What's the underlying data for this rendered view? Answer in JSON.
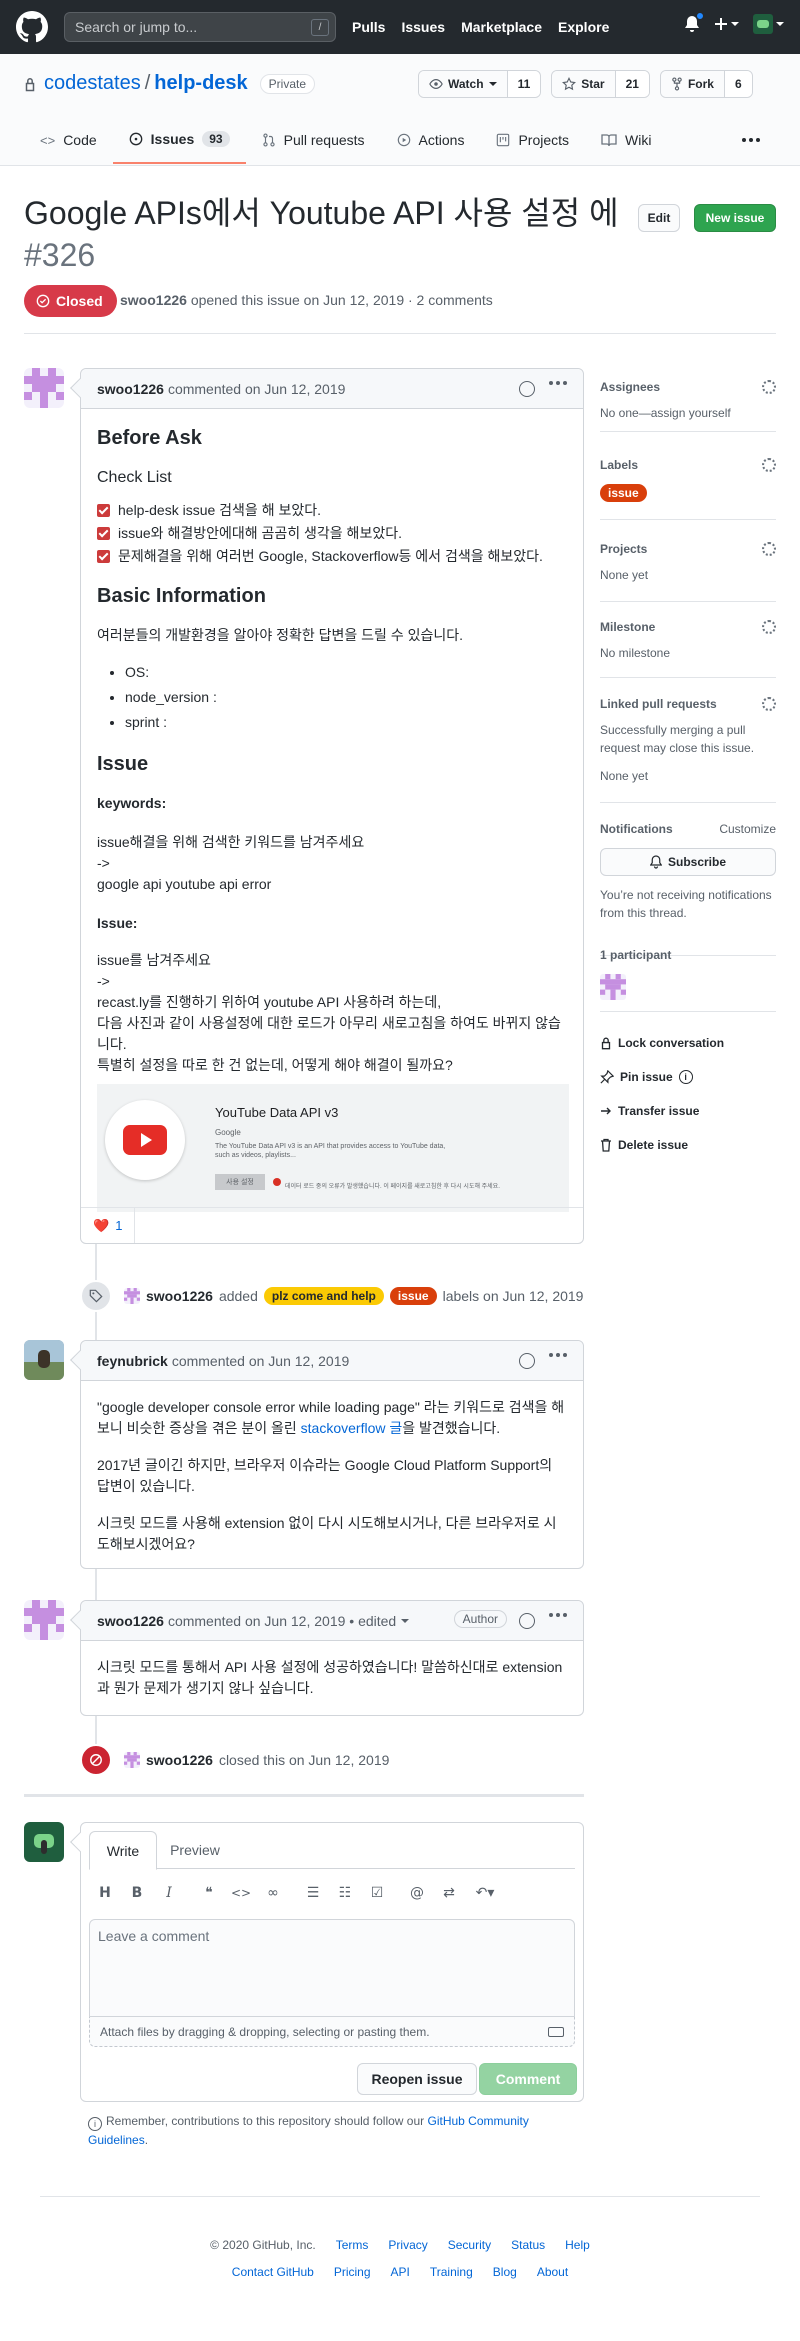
{
  "topbar": {
    "search_placeholder": "Search or jump to...",
    "slash_key": "/",
    "nav": [
      "Pulls",
      "Issues",
      "Marketplace",
      "Explore"
    ]
  },
  "repo": {
    "owner": "codestates",
    "separator": "/",
    "name": "help-desk",
    "visibility": "Private",
    "watch_label": "Watch",
    "watch_count": "11",
    "star_label": "Star",
    "star_count": "21",
    "fork_label": "Fork",
    "fork_count": "6"
  },
  "tabs": [
    {
      "label": "Code",
      "icon": "code-icon"
    },
    {
      "label": "Issues",
      "icon": "issue-opened-icon",
      "count": "93"
    },
    {
      "label": "Pull requests",
      "icon": "git-pull-request-icon"
    },
    {
      "label": "Actions",
      "icon": "play-icon"
    },
    {
      "label": "Projects",
      "icon": "project-icon"
    },
    {
      "label": "Wiki",
      "icon": "book-icon"
    }
  ],
  "issue": {
    "title": "Google APIs에서 Youtube API 사용 설정 에",
    "number": "#326",
    "edit_label": "Edit",
    "new_issue_label": "New issue",
    "state": "Closed",
    "author": "swoo1226",
    "meta": "opened this issue on Jun 12, 2019 · 2 comments"
  },
  "comment1": {
    "author": "swoo1226",
    "meta": "commented on Jun 12, 2019",
    "before_ask": "Before Ask",
    "checklist_title": "Check List",
    "checklist": [
      "help-desk issue 검색을 해 보았다.",
      "issue와 해결방안에대해 곰곰히 생각을 해보았다.",
      "문제해결을 위해 여러번 Google, Stackoverflow등 에서 검색을 해보았다."
    ],
    "basic_info_title": "Basic Information",
    "basic_info_desc": "여러분들의 개발환경을 알아야 정확한 답변을 드릴 수 있습니다.",
    "basic_info_items": [
      "OS:",
      "node_version :",
      "sprint :"
    ],
    "issue_title": "Issue",
    "keywords_label": "keywords:",
    "keywords_lines": [
      "issue해결을 위해 검색한 키워드를 남겨주세요",
      "->",
      "google api youtube api error"
    ],
    "issue_label": "Issue:",
    "issue_lines": [
      "issue를 남겨주세요",
      "->",
      "recast.ly를 진행하기 위하여 youtube API 사용하려 하는데,",
      "다음 사진과 같이 사용설정에 대한 로드가 아무리 새로고침을 하여도 바뀌지 않습니다.",
      "특별히 설정을 따로 한 건 없는데, 어떻게 해야 해결이 될까요?"
    ],
    "screenshot": {
      "title": "YouTube Data API v3",
      "vendor": "Google",
      "desc": "The YouTube Data API v3 is an API that provides access to YouTube data, such as videos, playlists...",
      "button": "사용 설정",
      "error": "데이터 로드 중의 오류가 발생했습니다. 이 페이지를 새로고침한 후 다시 시도해 주세요."
    },
    "reaction_emoji": "❤️",
    "reaction_count": "1"
  },
  "event_labels": {
    "author": "swoo1226",
    "added": "added",
    "labels": [
      "plz come and help",
      "issue"
    ],
    "suffix": "labels on Jun 12, 2019"
  },
  "comment2": {
    "author": "feynubrick",
    "meta": "commented on Jun 12, 2019",
    "p1_a": "\"google developer console error while loading page\" 라는 키워드로 검색을 해보니 비슷한 증상을 겪은 분이 올린 ",
    "p1_link": "stackoverflow 글",
    "p1_b": "을 발견했습니다.",
    "p2": "2017년 글이긴 하지만, 브라우저 이슈라는 Google Cloud Platform Support의 답변이 있습니다.",
    "p3": "시크릿 모드를 사용해 extension 없이 다시 시도해보시거나, 다른 브라우저로 시도해보시겠어요?"
  },
  "comment3": {
    "author": "swoo1226",
    "meta": "commented on Jun 12, 2019 • edited",
    "badge": "Author",
    "body": "시크릿 모드를 통해서 API 사용 설정에 성공하였습니다! 말씀하신대로 extension과 뭔가 문제가 생기지 않나 싶습니다."
  },
  "event_closed": {
    "author": "swoo1226",
    "text": "closed this on Jun 12, 2019"
  },
  "editor": {
    "tab_write": "Write",
    "tab_preview": "Preview",
    "placeholder": "Leave a comment",
    "attach": "Attach files by dragging & dropping, selecting or pasting them.",
    "reopen_label": "Reopen issue",
    "comment_label": "Comment",
    "guidelines_a": "Remember, contributions to this repository should follow our ",
    "guidelines_link": "GitHub Community Guidelines",
    "guidelines_b": "."
  },
  "sidebar": {
    "assignees_title": "Assignees",
    "assignees_value": "No one—assign yourself",
    "labels_title": "Labels",
    "label_value": "issue",
    "projects_title": "Projects",
    "projects_value": "None yet",
    "milestone_title": "Milestone",
    "milestone_value": "No milestone",
    "linked_title": "Linked pull requests",
    "linked_desc": "Successfully merging a pull request may close this issue.",
    "linked_value": "None yet",
    "notifications_title": "Notifications",
    "customize": "Customize",
    "subscribe": "Subscribe",
    "notif_desc": "You’re not receiving notifications from this thread.",
    "participants": "1 participant",
    "lock": "Lock conversation",
    "pin": "Pin issue",
    "transfer": "Transfer issue",
    "delete": "Delete issue"
  },
  "footer": {
    "copyright": "© 2020 GitHub, Inc.",
    "row1": [
      "Terms",
      "Privacy",
      "Security",
      "Status",
      "Help"
    ],
    "row2": [
      "Contact GitHub",
      "Pricing",
      "API",
      "Training",
      "Blog",
      "About"
    ]
  },
  "colors": {
    "closed_red": "#d73a49",
    "green": "#2ea44f",
    "label_yellow": "#fbca04",
    "label_orange": "#d93f0b",
    "link_blue": "#0366d6",
    "header_dark": "#24292e"
  }
}
